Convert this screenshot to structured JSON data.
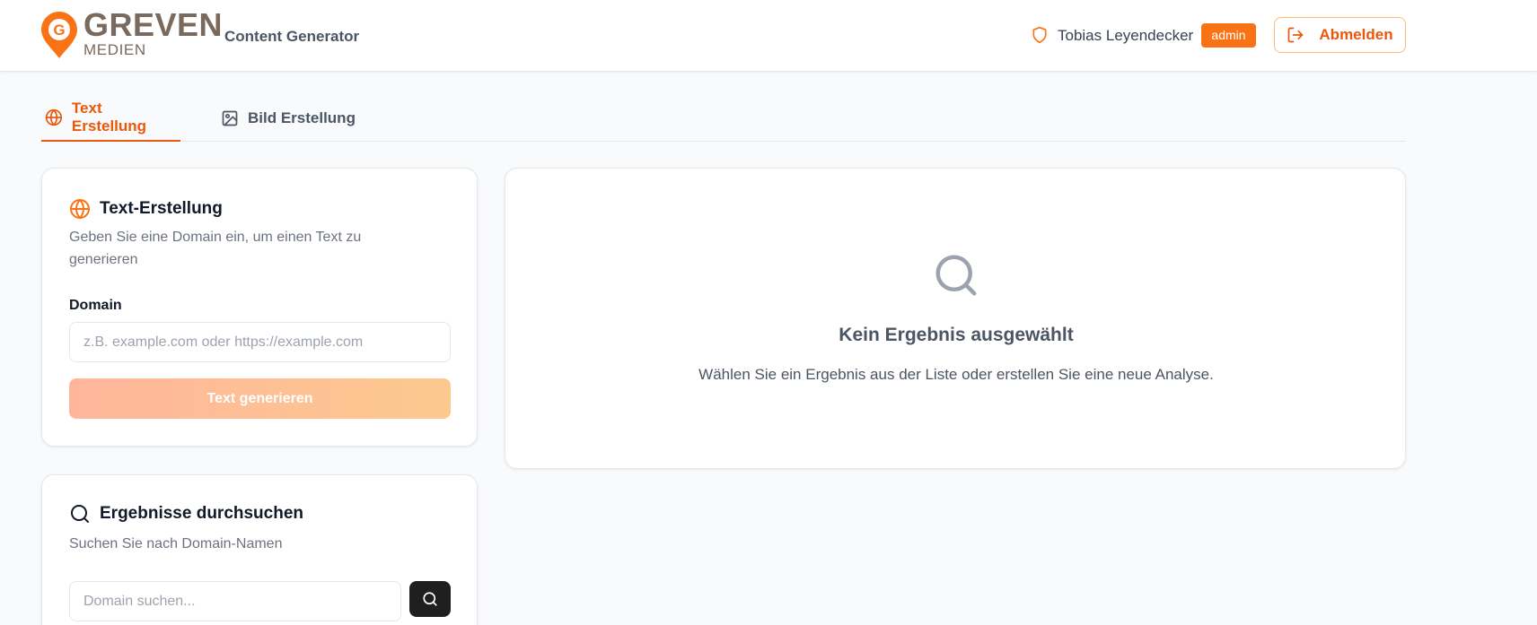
{
  "header": {
    "brand_name": "GREVEN",
    "brand_sub": "MEDIEN",
    "app_name": "Content Generator",
    "user_name": "Tobias Leyendecker",
    "role": "admin",
    "logout_label": "Abmelden"
  },
  "tabs": [
    {
      "label": "Text Erstellung",
      "active": true
    },
    {
      "label": "Bild Erstellung",
      "active": false
    }
  ],
  "create_card": {
    "title": "Text-Erstellung",
    "description": "Geben Sie eine Domain ein, um einen Text zu generieren",
    "field_label": "Domain",
    "input_value": "",
    "input_placeholder": "z.B. example.com oder https://example.com",
    "button_label": "Text generieren"
  },
  "search_card": {
    "title": "Ergebnisse durchsuchen",
    "description": "Suchen Sie nach Domain-Namen",
    "input_value": "",
    "input_placeholder": "Domain suchen..."
  },
  "result_card": {
    "title": "Kein Ergebnis ausgewählt",
    "description": "Wählen Sie ein Ergebnis aus der Liste oder erstellen Sie eine neue Analyse."
  },
  "colors": {
    "accent": "#ea580c",
    "badge": "#f97316",
    "brand": "#7a6a5d"
  }
}
